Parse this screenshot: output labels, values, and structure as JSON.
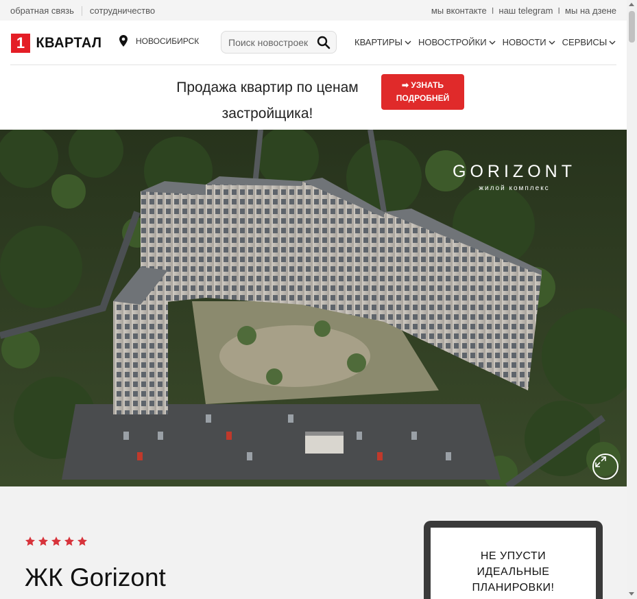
{
  "topbar": {
    "feedback": "обратная связь",
    "cooperation": "сотрудничество",
    "vk": "мы вконтакте",
    "sep": "I",
    "telegram": "наш telegram",
    "dzen": "мы на дзене"
  },
  "header": {
    "logo_number": "1",
    "logo_word": "КВАРТАЛ",
    "city": "НОВОСИБИРСК",
    "search_placeholder": "Поиск новостроек",
    "nav": [
      "КВАРТИРЫ",
      "НОВОСТРОЙКИ",
      "НОВОСТИ",
      "СЕРВИСЫ"
    ]
  },
  "promo": {
    "text": "Продажа квартир по ценам застройщика!",
    "button_line1": "➡ УЗНАТЬ",
    "button_line2": "ПОДРОБНЕЙ"
  },
  "hero": {
    "brand_name": "GORIZONT",
    "brand_sub": "жилой комплекс"
  },
  "listing": {
    "rating_stars": 5,
    "title": "ЖК Gorizont"
  },
  "card": {
    "line1": "НЕ УПУСТИ",
    "line2": "ИДЕАЛЬНЫЕ",
    "line3": "ПЛАНИРОВКИ!"
  },
  "colors": {
    "accent": "#e02a2a",
    "star": "#d7333b"
  }
}
